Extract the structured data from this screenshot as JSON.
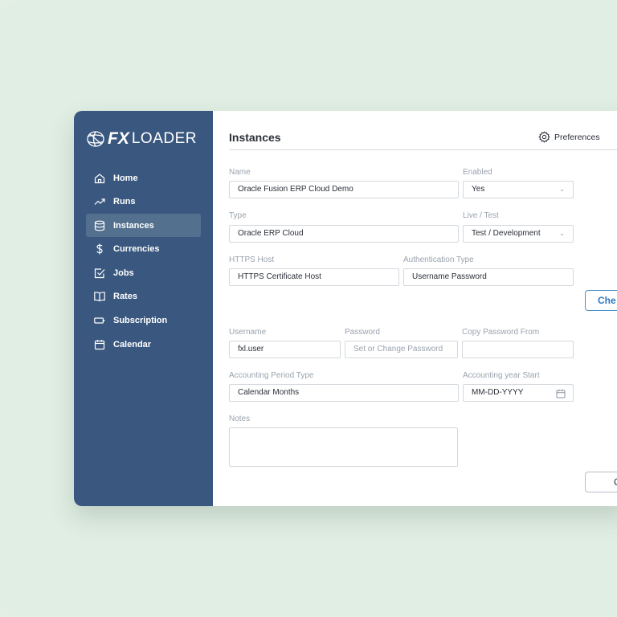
{
  "app": {
    "logo_fx": "FX",
    "logo_loader": "LOADER"
  },
  "sidebar": {
    "items": [
      {
        "label": "Home",
        "icon": "home-icon",
        "active": false
      },
      {
        "label": "Runs",
        "icon": "trend-icon",
        "active": false
      },
      {
        "label": "Instances",
        "icon": "database-icon",
        "active": true
      },
      {
        "label": "Currencies",
        "icon": "dollar-icon",
        "active": false
      },
      {
        "label": "Jobs",
        "icon": "checkbox-icon",
        "active": false
      },
      {
        "label": "Rates",
        "icon": "book-icon",
        "active": false
      },
      {
        "label": "Subscription",
        "icon": "battery-icon",
        "active": false
      },
      {
        "label": "Calendar",
        "icon": "calendar-icon",
        "active": false
      }
    ]
  },
  "header": {
    "title": "Instances",
    "preferences_label": "Preferences"
  },
  "form": {
    "name_label": "Name",
    "name_value": "Oracle Fusion ERP Cloud Demo",
    "enabled_label": "Enabled",
    "enabled_value": "Yes",
    "type_label": "Type",
    "type_value": "Oracle ERP Cloud",
    "livetest_label": "Live / Test",
    "livetest_value": "Test / Development",
    "host_label": "HTTPS Host",
    "host_value": "HTTPS Certificate Host",
    "auth_label": "Authentication Type",
    "auth_value": "Username Password",
    "check_button": "Che",
    "username_label": "Username",
    "username_value": "fxl.user",
    "password_label": "Password",
    "password_placeholder": "Set or Change Password",
    "copypw_label": "Copy Password From",
    "copypw_value": "",
    "period_label": "Accounting Period Type",
    "period_value": "Calendar Months",
    "yearstart_label": "Accounting year Start",
    "yearstart_placeholder": "MM-DD-YYYY",
    "notes_label": "Notes",
    "notes_value": "",
    "cancel_button": "C"
  },
  "colors": {
    "sidebar": "#3a587f",
    "active_item": "#53708f",
    "accent": "#2b78be",
    "background": "#e0eee3"
  }
}
